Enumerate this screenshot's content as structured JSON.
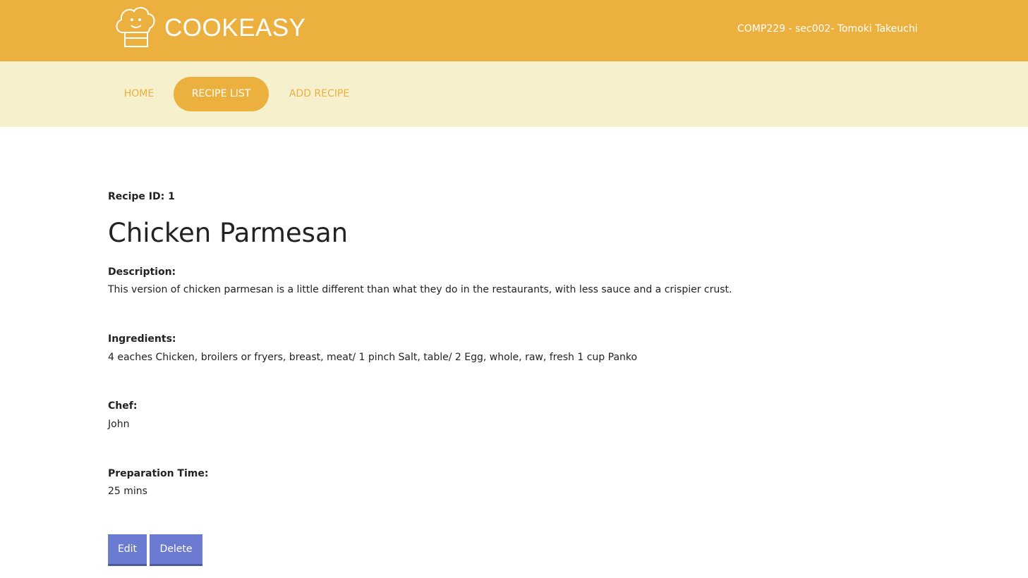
{
  "header": {
    "brand": "COOKEASY",
    "course_info": "COMP229 - sec002- Tomoki Takeuchi",
    "logo_icon": "chef-hat-icon"
  },
  "nav": {
    "items": [
      {
        "label": "HOME",
        "active": false
      },
      {
        "label": "RECIPE LIST",
        "active": true
      },
      {
        "label": "ADD RECIPE",
        "active": false
      }
    ]
  },
  "recipe": {
    "id_label": "Recipe ID: 1",
    "name": "Chicken Parmesan",
    "description_label": "Description:",
    "description": "This version of chicken parmesan is a little different than what they do in the restaurants, with less sauce and a crispier crust.",
    "ingredients_label": "Ingredients:",
    "ingredients": "4 eaches Chicken, broilers or fryers, breast, meat/ 1 pinch Salt, table/ 2 Egg, whole, raw, fresh 1 cup Panko",
    "chef_label": "Chef:",
    "chef": "John",
    "prep_label": "Preparation Time:",
    "prep_time": "25 mins"
  },
  "actions": {
    "edit_label": "Edit",
    "delete_label": "Delete"
  },
  "colors": {
    "header_bg": "#ecb03f",
    "nav_bg": "#f6f0cd",
    "button_bg": "#6b7bd1"
  }
}
